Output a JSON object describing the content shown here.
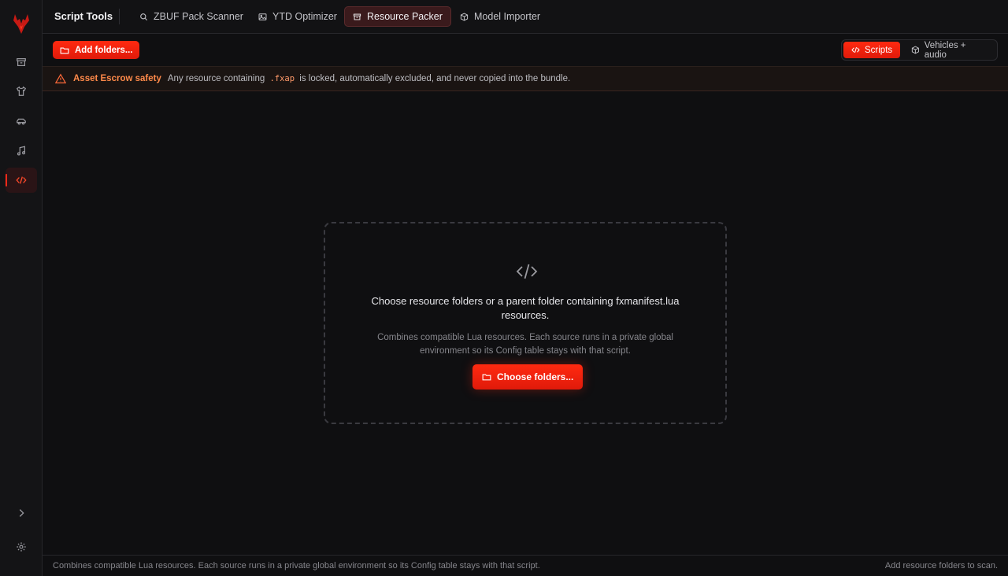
{
  "header": {
    "title": "Script Tools",
    "tabs": [
      {
        "label": "ZBUF Pack Scanner",
        "icon": "search-icon"
      },
      {
        "label": "YTD Optimizer",
        "icon": "image-icon"
      },
      {
        "label": "Resource Packer",
        "icon": "archive-icon",
        "active": true
      },
      {
        "label": "Model Importer",
        "icon": "cube-icon"
      }
    ]
  },
  "sidebar": {
    "items": [
      {
        "icon": "archive-icon"
      },
      {
        "icon": "shirt-icon"
      },
      {
        "icon": "car-icon"
      },
      {
        "icon": "music-icon"
      },
      {
        "icon": "code-icon",
        "active": true
      }
    ],
    "bottom": [
      {
        "icon": "chevron-right-icon"
      },
      {
        "icon": "gear-icon"
      }
    ]
  },
  "toolbar": {
    "add_label": "Add folders...",
    "modes": [
      {
        "label": "Scripts",
        "icon": "code-icon",
        "active": true
      },
      {
        "label": "Vehicles + audio",
        "icon": "cube-icon"
      }
    ]
  },
  "warning": {
    "title": "Asset Escrow safety",
    "text_before": "Any resource containing",
    "code": ".fxap",
    "text_after": "is locked, automatically excluded, and never copied into the bundle."
  },
  "dropzone": {
    "title": "Choose resource folders or a parent folder containing fxmanifest.lua resources.",
    "subtitle": "Combines compatible Lua resources. Each source runs in a private global environment so its Config table stays with that script.",
    "button_label": "Choose folders..."
  },
  "status": {
    "left": "Combines compatible Lua resources. Each source runs in a private global environment so its Config table stays with that script.",
    "right": "Add resource folders to scan."
  },
  "colors": {
    "accent": "#ff2a10",
    "background": "#0f0f11",
    "warning": "#ff8a4a"
  }
}
